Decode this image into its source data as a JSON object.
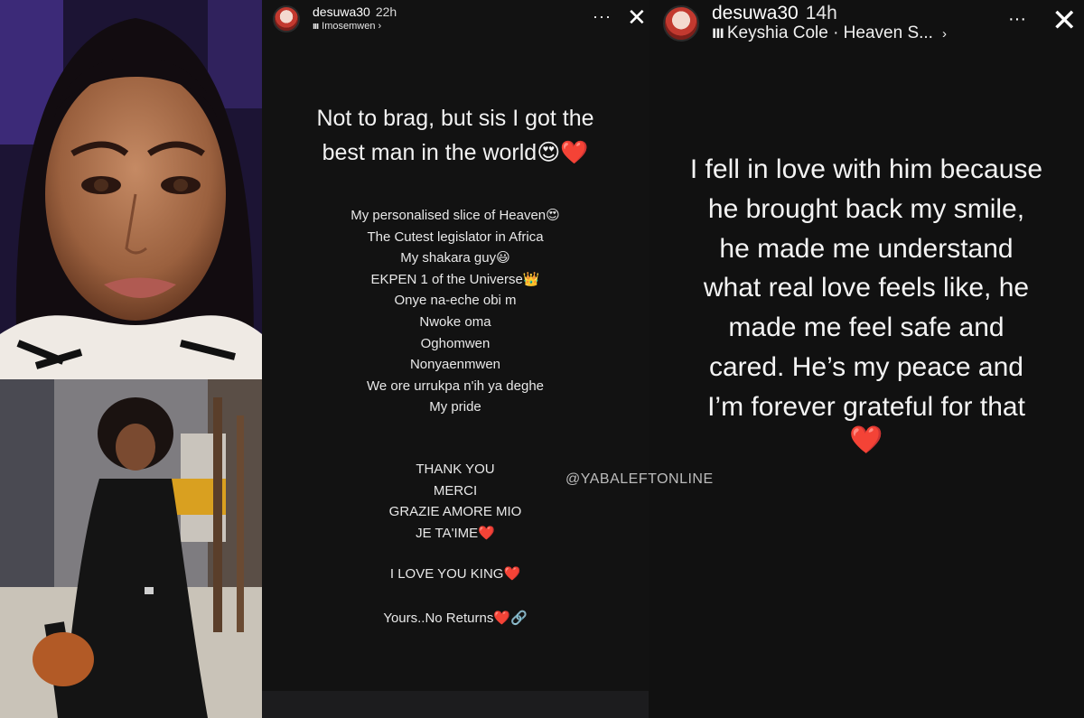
{
  "photos": {
    "top": {
      "description_icon": "portrait-photo"
    },
    "bottom": {
      "description_icon": "street-photo"
    }
  },
  "story_left": {
    "username": "desuwa30",
    "time": "22h",
    "music": "Imosemwen",
    "music_chevron": "›",
    "menu": "···",
    "close": "✕",
    "headline_lines": [
      "Not to brag, but sis I got the",
      "best man in the world😍❤️"
    ],
    "list": [
      "My personalised slice of Heaven😍",
      "The Cutest legislator in Africa",
      "My shakara guy😃",
      "EKPEN 1 of the Universe👑",
      "Onye na-eche obi m",
      "Nwoke oma",
      "Oghomwen",
      "Nonyaenmwen",
      "We ore urrukpa n'ih ya deghe",
      "My pride"
    ],
    "thanks": [
      "THANK YOU",
      "MERCI",
      "GRAZIE AMORE MIO",
      "JE TA'IME❤️"
    ],
    "love": "I LOVE YOU KING❤️",
    "yours": "Yours..No Returns❤️🔗"
  },
  "story_right": {
    "username": "desuwa30",
    "time": "14h",
    "music": "Keyshia Cole · Heaven S...",
    "music_chevron": "›",
    "menu": "···",
    "close": "✕",
    "body_lines": [
      "I fell in love with him because",
      "he brought back my smile,",
      "he made me understand",
      "what real love feels like, he",
      "made me feel safe and",
      "cared. He’s my peace and",
      "I’m forever grateful for that"
    ],
    "heart": "❤️"
  },
  "watermark": "@YABALEFTONLINE",
  "colors": {
    "heart": "#e8202a",
    "story_bg": "#121212"
  }
}
